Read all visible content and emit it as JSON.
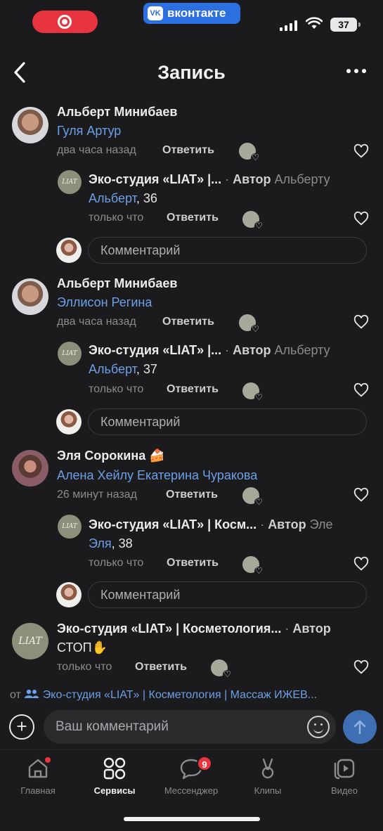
{
  "status_bar": {
    "app_badge": "вконтакте",
    "vk_logo": "VK",
    "battery": "37"
  },
  "header": {
    "title": "Запись"
  },
  "comments": [
    {
      "author": "Альберт Минибаев",
      "mentions": "Гуля Артур",
      "time": "два часа назад",
      "reply": "Ответить",
      "answer": {
        "author": "Эко-студия «LIAT» |...",
        "sep": " · ",
        "badge": "Автор",
        "to": "Альберту",
        "mention": "Альберт",
        "text": ", 36",
        "time": "только что",
        "reply": "Ответить"
      }
    },
    {
      "author": "Альберт Минибаев",
      "mentions": "Эллисон Регина",
      "time": "два часа назад",
      "reply": "Ответить",
      "answer": {
        "author": "Эко-студия «LIAT» |...",
        "sep": " · ",
        "badge": "Автор",
        "to": "Альберту",
        "mention": "Альберт",
        "text": ", 37",
        "time": "только что",
        "reply": "Ответить"
      }
    },
    {
      "author": "Эля Сорокина 🍰",
      "mentions": "Алена Хейлу Екатерина Чуракова",
      "time": "26 минут назад",
      "reply": "Ответить",
      "answer": {
        "author": "Эко-студия «LIAT» | Косм...",
        "sep": " · ",
        "badge": "Автор",
        "to": "Эле",
        "mention": "Эля",
        "text": ", 38",
        "time": "только что",
        "reply": "Ответить"
      }
    }
  ],
  "last_comment": {
    "author": "Эко-студия «LIAT» | Косметология...",
    "sep": " · ",
    "badge": "Автор",
    "text": "СТОП✋",
    "time": "только что",
    "reply": "Ответить"
  },
  "comment_placeholder": "Комментарий",
  "avatar_logo": "LIAT",
  "from": {
    "prefix": "от",
    "group": "Эко-студия «LIAT» | Косметология | Массаж ИЖЕВ..."
  },
  "composer": {
    "placeholder": "Ваш комментарий",
    "plus": "+"
  },
  "tabs": [
    {
      "label": "Главная"
    },
    {
      "label": "Сервисы"
    },
    {
      "label": "Мессенджер",
      "badge": "9"
    },
    {
      "label": "Клипы"
    },
    {
      "label": "Видео"
    }
  ],
  "colors": {
    "background": "#1b1b1d",
    "link": "#6c9fe6",
    "accent_red": "#e8343e",
    "send": "#3f6fb2"
  }
}
